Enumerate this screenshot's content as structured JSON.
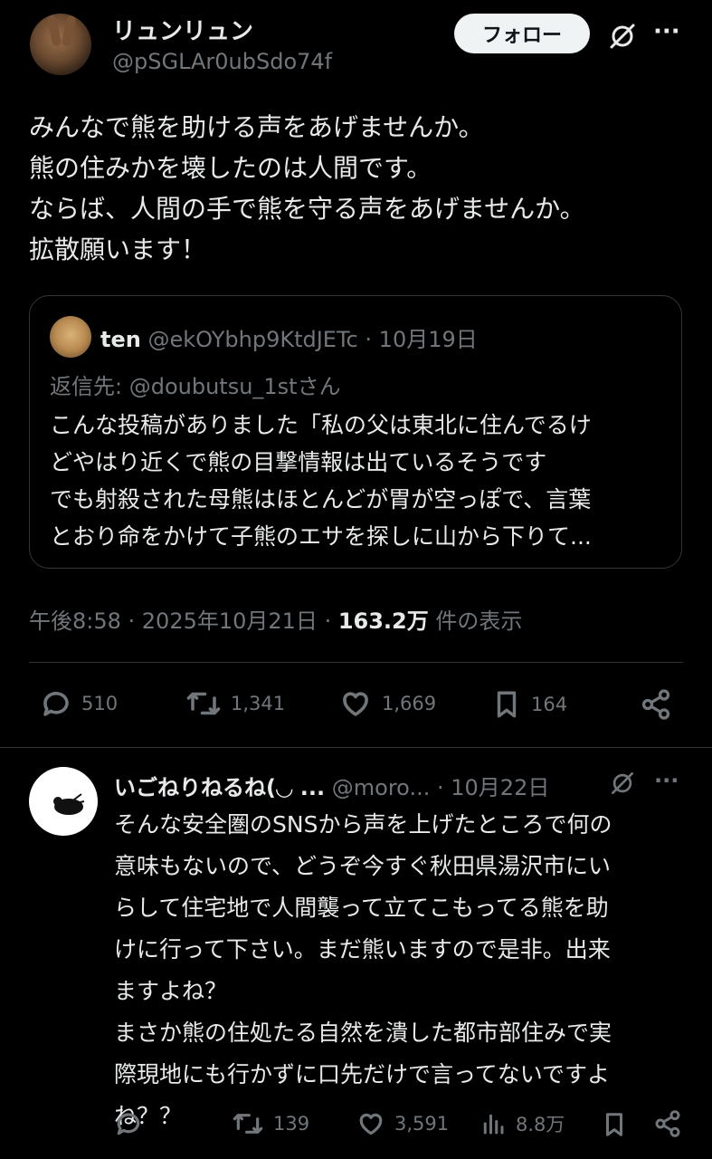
{
  "post": {
    "display_name": "リュンリュン",
    "handle": "@pSGLAr0ubSdo74f",
    "follow_label": "フォロー",
    "more_label": "···",
    "text_lines": [
      "みんなで熊を助ける声をあげませんか。",
      "熊の住みかを壊したのは人間です。",
      "ならば、人間の手で熊を守る声をあげませんか。",
      "拡散願います！"
    ],
    "quote": {
      "name": "ten",
      "handle": "@ekOYbhp9KtdJETc",
      "sep": "·",
      "date": "10月19日",
      "reply_to": "返信先: @doubutsu_1stさん",
      "text_lines": [
        "こんな投稿がありました「私の父は東北に住んでるけ",
        "どやはり近くで熊の目撃情報は出ているそうです",
        "でも射殺された母熊はほとんどが胃が空っぽで、言葉",
        "とおり命をかけて子熊のエサを探しに山から下りて..."
      ]
    },
    "meta": {
      "time": "午後8:58 · 2025年10月21日 · ",
      "views": "163.2万",
      "views_suffix": " 件の表示"
    },
    "actions": {
      "replies": "510",
      "reposts": "1,341",
      "likes": "1,669",
      "bookmarks": "164"
    }
  },
  "reply": {
    "display_name": "いごねりねるね(◡ ...",
    "handle": "@moro...",
    "sep": "·",
    "date": "10月22日",
    "more_label": "···",
    "text_lines": [
      "そんな安全圏のSNSから声を上げたところで何の",
      "意味もないので、どうぞ今すぐ秋田県湯沢市にい",
      "らして住宅地で人間襲って立てこもってる熊を助",
      "けに行って下さい。まだ熊いますので是非。出来",
      "ますよね？",
      "まさか熊の住処たる自然を潰した都市部住みで実",
      "際現地にも行かずに口先だけで言ってないですよ",
      "ね？？"
    ],
    "actions": {
      "reposts": "139",
      "likes": "3,591",
      "views": "8.8万"
    }
  }
}
